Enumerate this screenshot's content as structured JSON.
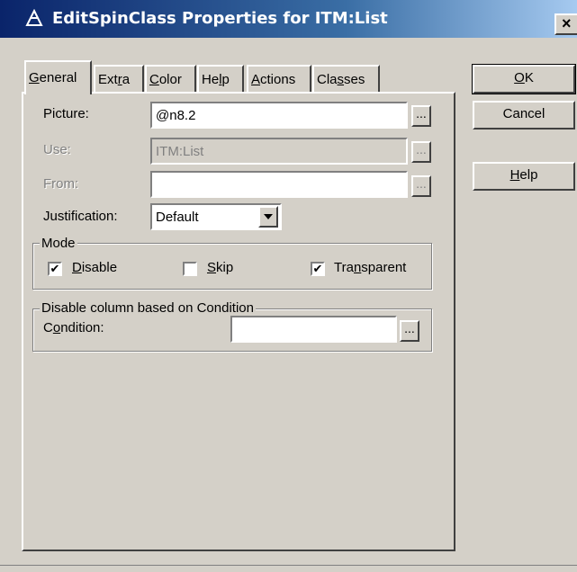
{
  "window": {
    "title": "EditSpinClass Properties for ITM:List",
    "close_glyph": "✕"
  },
  "tabs": [
    {
      "label": "General",
      "access": "G",
      "active": true
    },
    {
      "label": "Extra",
      "access": "r"
    },
    {
      "label": "Color",
      "access": "C"
    },
    {
      "label": "Help",
      "access": "l"
    },
    {
      "label": "Actions",
      "access": "A"
    },
    {
      "label": "Classes",
      "access": "s"
    }
  ],
  "form": {
    "picture_label": "Picture:",
    "picture_value": "@n8.2",
    "use_label": "Use:",
    "use_value": "ITM:List",
    "from_label": "From:",
    "from_value": "",
    "justification_label": "Justification:",
    "justification_value": "Default",
    "ellipsis": "..."
  },
  "mode": {
    "title": "Mode",
    "disable_label": "Disable",
    "disable_checked": true,
    "skip_label": "Skip",
    "skip_checked": false,
    "transparent_label": "Transparent",
    "transparent_checked": true
  },
  "condition_group": {
    "title": "Disable column based on Condition",
    "condition_label": "Condition:",
    "condition_value": ""
  },
  "buttons": {
    "ok": "OK",
    "cancel": "Cancel",
    "help": "Help"
  },
  "colors": {
    "face": "#d4d0c8",
    "title_start": "#0a246a",
    "title_end": "#a6caf0"
  }
}
